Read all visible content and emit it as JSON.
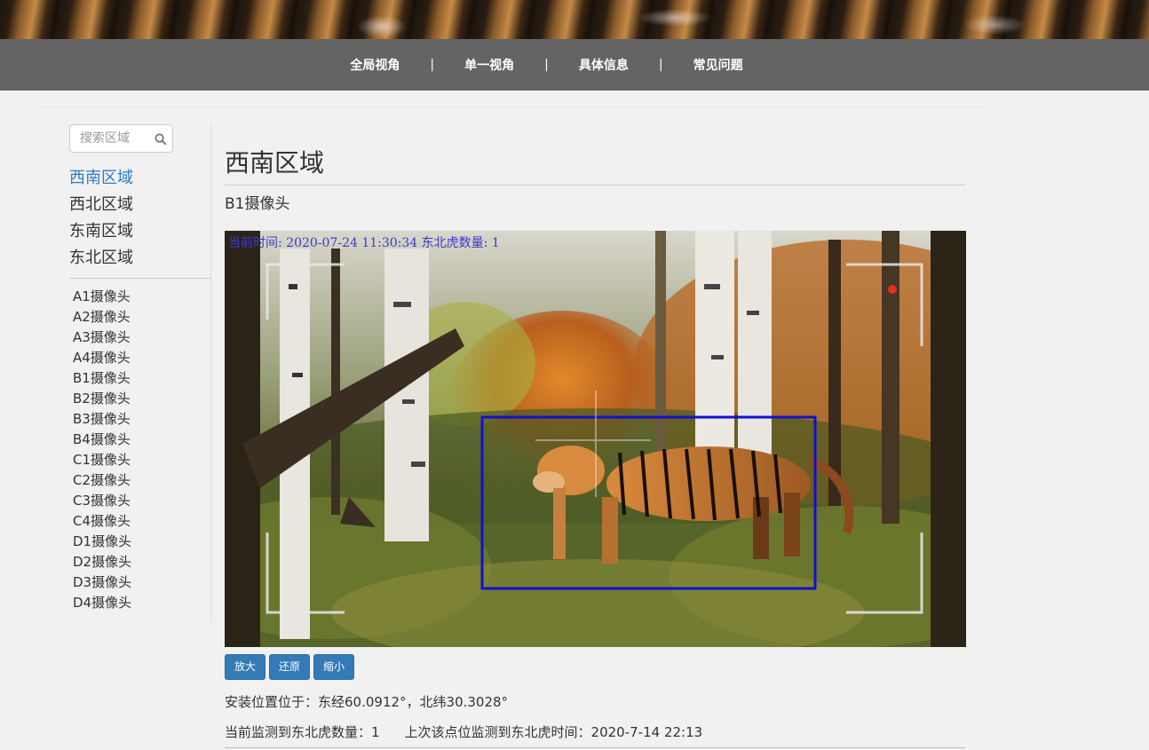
{
  "nav": {
    "items": [
      "全局视角",
      "单一视角",
      "具体信息",
      "常见问题"
    ],
    "separator": "|"
  },
  "sidebar": {
    "search_placeholder": "搜索区域",
    "regions": [
      "西南区域",
      "西北区域",
      "东南区域",
      "东北区域"
    ],
    "active_region": "西南区域",
    "cameras": [
      "A1摄像头",
      "A2摄像头",
      "A3摄像头",
      "A4摄像头",
      "B1摄像头",
      "B2摄像头",
      "B3摄像头",
      "B4摄像头",
      "C1摄像头",
      "C2摄像头",
      "C3摄像头",
      "C4摄像头",
      "D1摄像头",
      "D2摄像头",
      "D3摄像头",
      "D4摄像头"
    ]
  },
  "main": {
    "title": "西南区域",
    "camera_name": "B1摄像头",
    "video_overlay": "当前时间: 2020-07-24 11:30:34    东北虎数量: 1",
    "buttons": {
      "zoom_in": "放大",
      "reset": "还原",
      "zoom_out": "缩小"
    },
    "location": "安装位置位于：东经60.0912°，北纬30.3028°",
    "current_count": "当前监测到东北虎数量：1",
    "last_seen": "上次该点位监测到东北虎时间：2020-7-14 22:13"
  },
  "colors": {
    "nav_bg": "#646464",
    "active_link": "#2a7dc4",
    "button_bg": "#337ab7",
    "detection_box": "#1010d0"
  }
}
